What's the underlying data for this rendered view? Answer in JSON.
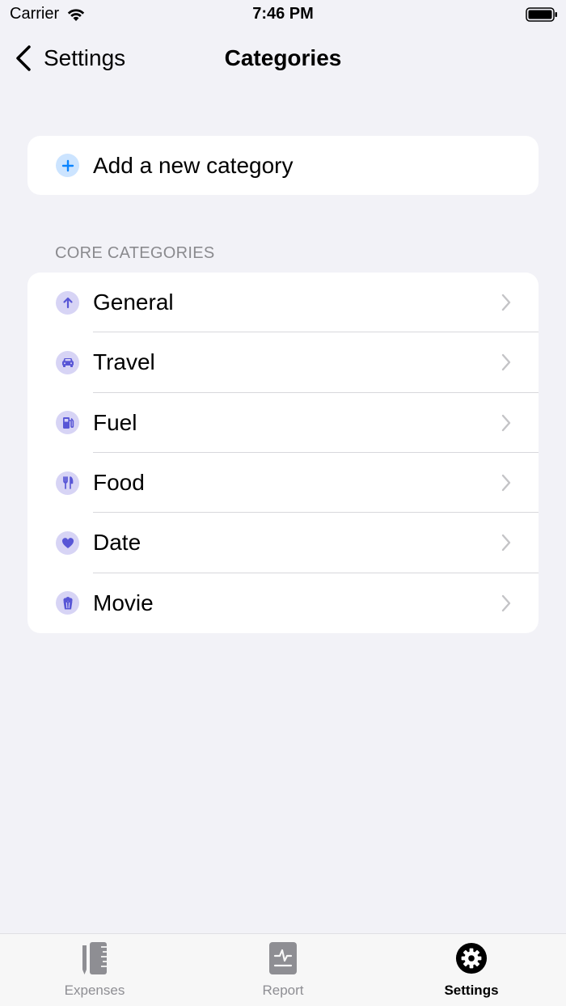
{
  "status_bar": {
    "carrier": "Carrier",
    "time": "7:46 PM"
  },
  "nav": {
    "back_label": "Settings",
    "title": "Categories"
  },
  "add_category": {
    "label": "Add a new category",
    "icon": "plus-icon"
  },
  "core_section": {
    "header": "CORE CATEGORIES",
    "items": [
      {
        "label": "General",
        "icon": "arrow-up-icon"
      },
      {
        "label": "Travel",
        "icon": "car-icon"
      },
      {
        "label": "Fuel",
        "icon": "fuel-pump-icon"
      },
      {
        "label": "Food",
        "icon": "fork-knife-icon"
      },
      {
        "label": "Date",
        "icon": "heart-icon"
      },
      {
        "label": "Movie",
        "icon": "popcorn-icon"
      }
    ]
  },
  "tab_bar": {
    "tabs": [
      {
        "label": "Expenses",
        "icon": "pencil-ruler-icon",
        "active": false
      },
      {
        "label": "Report",
        "icon": "report-icon",
        "active": false
      },
      {
        "label": "Settings",
        "icon": "gear-icon",
        "active": true
      }
    ]
  },
  "colors": {
    "background": "#f2f2f7",
    "accent_blue": "#0a84ff",
    "category_icon_fill": "#5856d6",
    "category_icon_bg": "#d7d4f5",
    "tab_inactive": "#8e8e93"
  }
}
